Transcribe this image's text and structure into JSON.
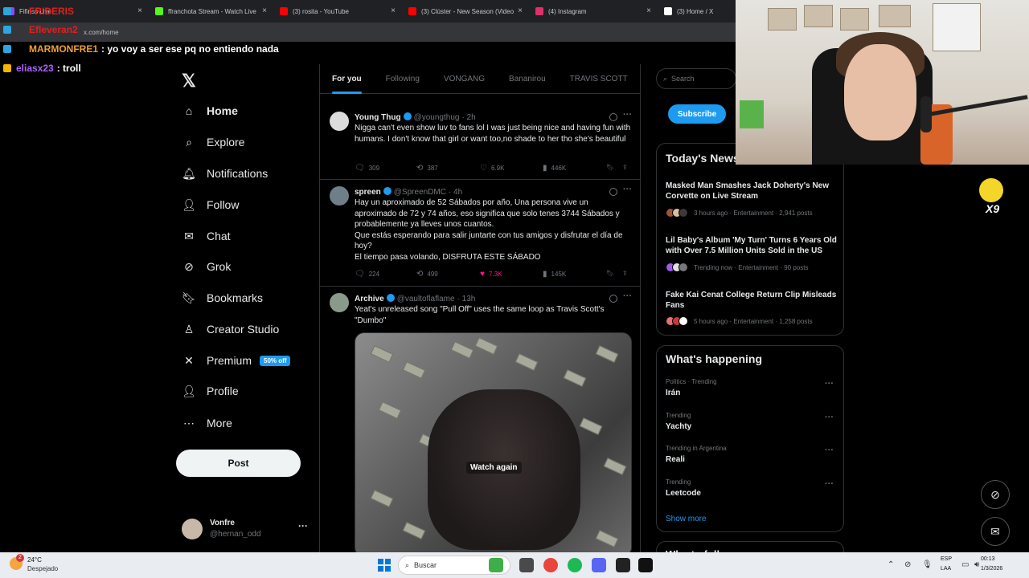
{
  "browser": {
    "tabs": [
      {
        "label": "Fifiriss Live",
        "color": "#9147ff"
      },
      {
        "label": "ffranchota Stream - Watch Live",
        "color": "#53fc18"
      },
      {
        "label": "(3) rosita - YouTube",
        "color": "#ff0000"
      },
      {
        "label": "(3) Clúster - New Season (Video",
        "color": "#ff0000"
      },
      {
        "label": "(4) Instagram",
        "color": "#e1306c"
      },
      {
        "label": "(3) Home / X",
        "color": "#ffffff"
      }
    ],
    "url": "x.com/home"
  },
  "chat": [
    {
      "user": "FRIDERIS",
      "user_color": "#e02020",
      "message": ""
    },
    {
      "user": "Efleveran2",
      "user_color": "#e02020",
      "message": ""
    },
    {
      "user": "MARMONFRE1",
      "user_color": "#f0a030",
      "message": ": yo voy a ser ese pq no entiendo nada"
    },
    {
      "user": "eliasx23",
      "user_color": "#b060ff",
      "message": ": troll"
    }
  ],
  "nav": {
    "logo": "𝕏",
    "items": [
      {
        "label": "Home",
        "icon": "home-icon",
        "glyph": "⌂"
      },
      {
        "label": "Explore",
        "icon": "search-icon",
        "glyph": "⌕"
      },
      {
        "label": "Notifications",
        "icon": "bell-icon",
        "glyph": "🔔︎"
      },
      {
        "label": "Follow",
        "icon": "follow-icon",
        "glyph": "👤︎"
      },
      {
        "label": "Chat",
        "icon": "mail-icon",
        "glyph": "✉"
      },
      {
        "label": "Grok",
        "icon": "grok-icon",
        "glyph": "⊘"
      },
      {
        "label": "Bookmarks",
        "icon": "bookmark-icon",
        "glyph": "🔖︎"
      },
      {
        "label": "Creator Studio",
        "icon": "creator-icon",
        "glyph": "♙"
      },
      {
        "label": "Premium",
        "icon": "x-icon",
        "glyph": "✕"
      },
      {
        "label": "Profile",
        "icon": "profile-icon",
        "glyph": "👤︎"
      },
      {
        "label": "More",
        "icon": "more-icon",
        "glyph": "⋯"
      }
    ],
    "premium_badge": "50% off",
    "post_label": "Post",
    "account": {
      "name": "Vonfre",
      "handle": "@hernan_odd"
    }
  },
  "feed": {
    "tabs": [
      "For you",
      "Following",
      "VONGANG",
      "Bananirou",
      "TRAVIS SCOTT"
    ],
    "tweets": [
      {
        "name": "Young Thug",
        "handle": "@youngthug",
        "time": "· 2h",
        "text": "Nigga can't even show luv to fans lol I was just being nice and having fun with humans. I don't know that girl or want too,no shade to her tho she's beautiful",
        "replies": "309",
        "reposts": "387",
        "likes": "6.9K",
        "views": "446K",
        "avatar_color": "#dcdcdc"
      },
      {
        "name": "spreen",
        "handle": "@SpreenDMC",
        "time": "· 4h",
        "text": "Hay un aproximado de 52 Sábados por año, Una persona vive un aproximado de 72 y 74 años, eso significa que solo tenes 3744 Sábados y probablemente ya lleves unos cuantos.\nQue estás esperando para salir juntarte con tus amigos y disfrutar el día de hoy?\nEl tiempo pasa volando, DISFRUTA ESTE SÁBADO",
        "replies": "224",
        "reposts": "499",
        "likes": "7.3K",
        "views": "145K",
        "avatar_color": "#6e7f8a"
      },
      {
        "name": "Archive",
        "handle": "@vaultoflaflame",
        "time": "· 13h",
        "text": "Yeat's unreleased song \"Pull Off\" uses the same loop as Travis Scott's \"Dumbo\"",
        "media_label": "Watch again",
        "avatar_color": "#8a9a8a"
      }
    ]
  },
  "right": {
    "search_placeholder": "Search",
    "subscribe_label": "Subscribe",
    "news_title": "Today's News",
    "news": [
      {
        "title": "Masked Man Smashes Jack Doherty's New Corvette on Live Stream",
        "meta": "3 hours ago · Entertainment · 2,941 posts"
      },
      {
        "title": "Lil Baby's Album 'My Turn' Turns 6 Years Old with Over 7.5 Million Units Sold in the US",
        "meta": "Trending now · Entertainment · 90 posts"
      },
      {
        "title": "Fake Kai Cenat College Return Clip Misleads Fans",
        "meta": "5 hours ago · Entertainment · 1,258 posts"
      }
    ],
    "happening_title": "What's happening",
    "trends": [
      {
        "context": "Politics · Trending",
        "name": "Irán"
      },
      {
        "context": "Trending",
        "name": "Yachty"
      },
      {
        "context": "Trending in Argentina",
        "name": "Reali"
      },
      {
        "context": "Trending",
        "name": "Leetcode"
      }
    ],
    "show_more": "Show more",
    "who_to_follow": "Who to follow"
  },
  "overlay": {
    "combo": "X9"
  },
  "taskbar": {
    "weather_temp": "24°C",
    "weather_desc": "Despejado",
    "weather_badge": "2",
    "search_label": "Buscar",
    "lang_1": "ESP",
    "lang_2": "LAA",
    "time": "00:13",
    "date": "1/3/2026"
  }
}
